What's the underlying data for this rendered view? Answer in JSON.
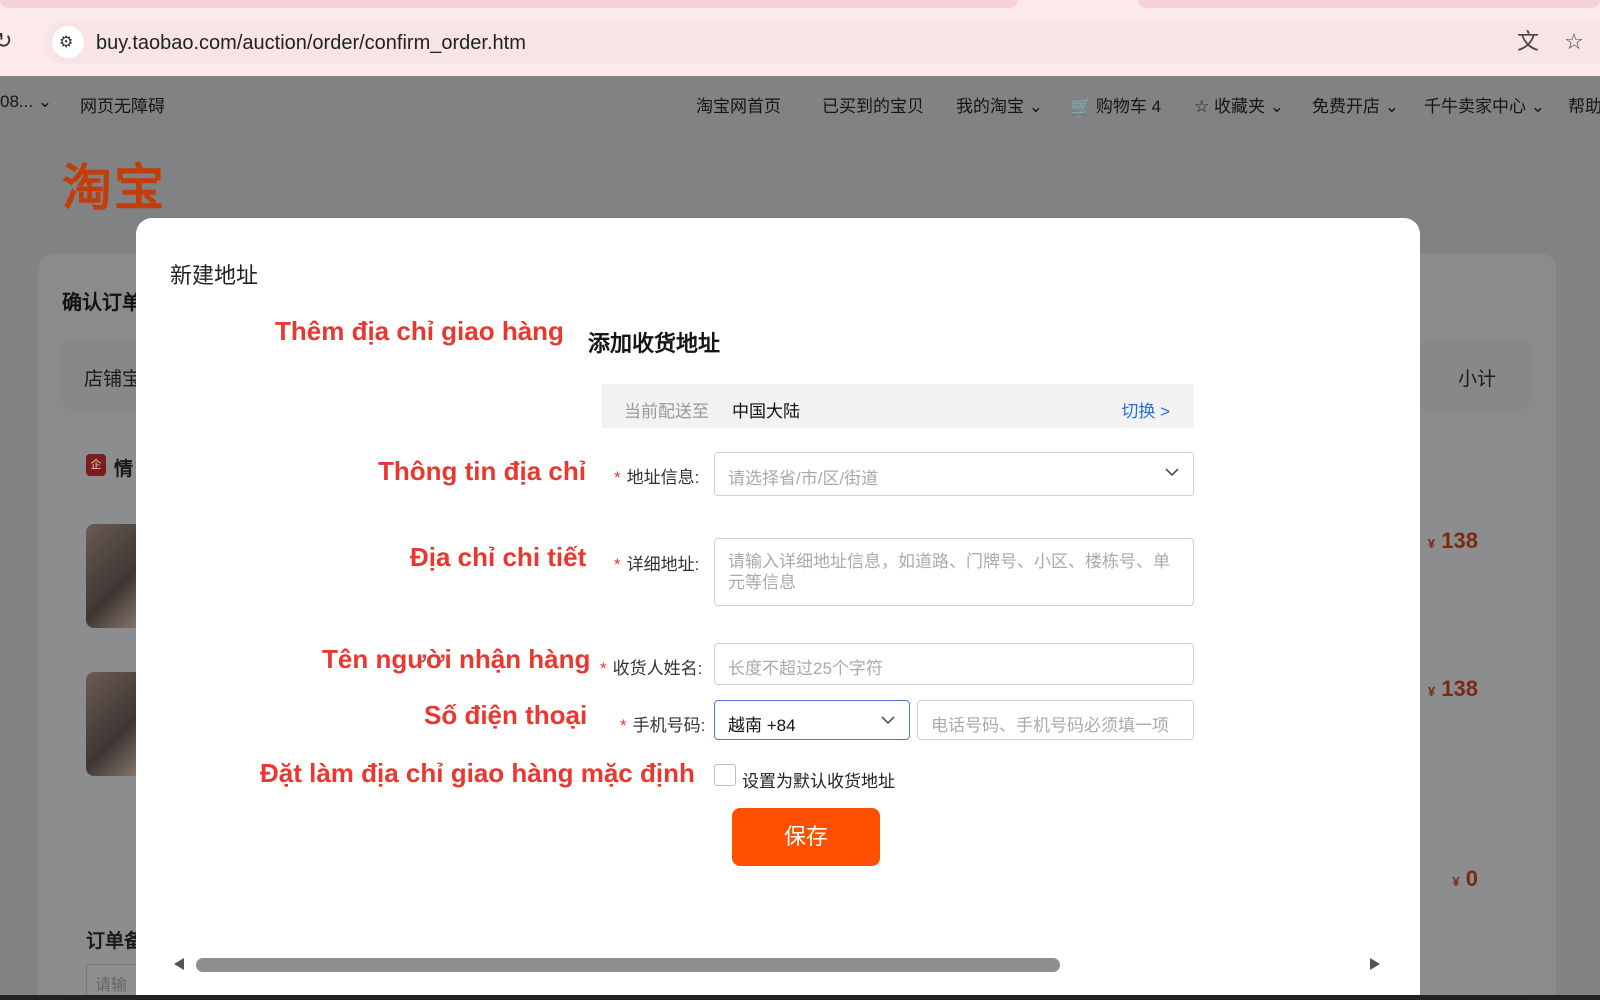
{
  "browser": {
    "url": "buy.taobao.com/auction/order/confirm_order.htm",
    "reload_icon": "reload-icon",
    "site_info_icon": "tune-icon",
    "translate_icon": "translate-icon",
    "bookmark_icon": "star-icon"
  },
  "topnav": {
    "left_truncated": "08...",
    "accessibility": "网页无障碍",
    "items": {
      "home": "淘宝网首页",
      "bought": "已买到的宝贝",
      "my_taobao": "我的淘宝",
      "cart": "购物车 4",
      "favorites": "收藏夹",
      "open_shop": "免费开店",
      "seller_center": "千牛卖家中心",
      "help": "帮助"
    }
  },
  "background": {
    "logo": "淘宝",
    "title": "确认订单",
    "header_left": "店铺宝",
    "header_right": "小计",
    "shop_name": "情",
    "items": [
      {
        "price": "138"
      },
      {
        "price": "138"
      }
    ],
    "currency": "¥",
    "note_label": "订单备",
    "note_placeholder": "请输",
    "total": "0"
  },
  "modal": {
    "title": "新建地址",
    "heading": "添加收货地址",
    "annotations": {
      "heading": "Thêm địa chỉ giao hàng",
      "address_info": "Thông tin địa chỉ",
      "detail_address": "Địa chỉ chi tiết",
      "recipient": "Tên người nhận hàng",
      "phone": "Số điện thoại",
      "default": "Đặt làm địa chỉ giao hàng mặc định"
    },
    "region": {
      "label": "当前配送至",
      "value": "中国大陆",
      "switch": "切换 >"
    },
    "fields": {
      "address_label": "地址信息:",
      "address_placeholder": "请选择省/市/区/街道",
      "detail_label": "详细地址:",
      "detail_placeholder": "请输入详细地址信息，如道路、门牌号、小区、楼栋号、单元等信息",
      "name_label": "收货人姓名:",
      "name_placeholder": "长度不超过25个字符",
      "phone_label": "手机号码:",
      "phone_code": "越南 +84",
      "phone_placeholder": "电话号码、手机号码必须填一项",
      "required_mark": "*"
    },
    "default_checkbox_label": "设置为默认收货地址",
    "save_label": "保存"
  },
  "colors": {
    "accent": "#ff5000",
    "annotation": "#e8382f",
    "link": "#2474c7"
  }
}
